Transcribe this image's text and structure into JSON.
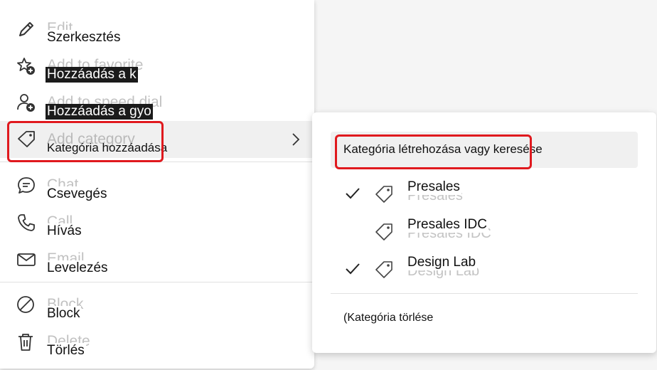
{
  "menu": {
    "items": [
      {
        "ghost": "Edit",
        "label": "Szerkesztés",
        "icon": "pencil-icon"
      },
      {
        "ghost": "Add to favorite",
        "label": "Hozzáadás a k",
        "icon": "star-add-icon"
      },
      {
        "ghost": "Add to speed dial",
        "label": "Hozzáadás a gyo",
        "icon": "person-add-icon"
      },
      {
        "ghost": "Add category",
        "label": "Kategória hozzáadása",
        "icon": "tag-icon"
      },
      {
        "ghost": "Chat",
        "label": "Csevegés",
        "icon": "chat-icon"
      },
      {
        "ghost": "Call",
        "label": "Hívás",
        "icon": "phone-icon"
      },
      {
        "ghost": "Email",
        "label": "Levelezés",
        "icon": "mail-icon"
      },
      {
        "ghost": "Block",
        "label": "Block",
        "icon": "block-icon"
      },
      {
        "ghost": "Delete",
        "label": "Törlés",
        "icon": "trash-icon"
      }
    ]
  },
  "submenu": {
    "search_label": "Kategória létrehozása vagy keresése",
    "categories": [
      {
        "label": "Presales",
        "ghost": "Presales",
        "checked": true
      },
      {
        "label": "Presales IDC",
        "ghost": "Presales IDC",
        "checked": false
      },
      {
        "label": "Design Lab",
        "ghost": "Design Lab",
        "checked": true
      }
    ],
    "delete_label": "(Kategória törlése"
  },
  "colors": {
    "highlight": "#e0191e",
    "hover_bg": "#f0f0f0"
  }
}
